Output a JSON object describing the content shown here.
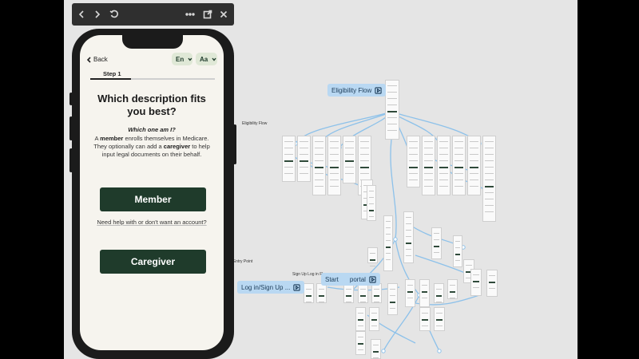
{
  "toolbar": {
    "back_icon": "chevron-left-icon",
    "forward_icon": "chevron-right-icon",
    "refresh_icon": "refresh-icon",
    "more_icon": "more-horizontal-icon",
    "open_icon": "open-external-icon",
    "close_icon": "close-icon"
  },
  "app": {
    "back_label": "Back",
    "language": "En",
    "text_size": "Aa",
    "step_label": "Step 1",
    "progress": 0.33,
    "heading": "Which description fits you best?",
    "question": "Which one am I?",
    "description_parts": {
      "p1": "A ",
      "member": "member",
      "p2": " enrolls themselves in Medicare. They optionally can add a ",
      "caregiver": "caregiver",
      "p3": " to help input legal documents on their behalf."
    },
    "member_button": "Member",
    "help_link": "Need help with or don't want an account?",
    "caregiver_button": "Caregiver"
  },
  "canvas": {
    "labels": {
      "eligibility_flow_small": "Eligibility Flow",
      "entry_point": "er Entry Point",
      "sign_up_small": "Sign Up Log in Flo"
    },
    "badges": {
      "eligibility": "Eligibility Flow",
      "start": "Start",
      "portal": "portal",
      "login": "Log in/Sign Up ..."
    },
    "accent": "#b9d8f2",
    "connector": "#8cc1ea"
  }
}
